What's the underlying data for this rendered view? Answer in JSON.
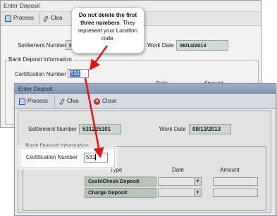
{
  "back_window": {
    "title": "Enter Deposit",
    "toolbar": {
      "process_label": "Process",
      "clear_label": "Clea"
    },
    "settlement_label": "Settlement Number",
    "settlement_value": "5",
    "workdate_label": "Work Date",
    "workdate_value": "08/13/2013",
    "group_title": "Bank Deposit Information",
    "cert_label": "Certification Number",
    "cert_value": "531",
    "col_date": "Date",
    "col_amount": "Amount"
  },
  "callout": {
    "bold_text": "Do not delete the first three numbers",
    "rest_text": ". They represent your Location code."
  },
  "front_window": {
    "title": "Enter Deposit",
    "toolbar": {
      "process_label": "Process",
      "clear_label": "Clea",
      "close_label": "Close"
    },
    "settlement_label": "Settlement Number",
    "settlement_value": "531225101",
    "workdate_label": "Work Date",
    "workdate_value": "08/13/2013",
    "group_title": "Bank Deposit Information",
    "cert_label": "Certification Number",
    "cert_value": "531",
    "col_type": "Type",
    "col_date": "Date",
    "col_amount": "Amount",
    "rows": [
      {
        "type": "Cash/Check Deposit"
      },
      {
        "type": "Charge Deposit"
      }
    ]
  },
  "colors": {
    "arrow": "#e01414",
    "selection": "#3a6fd0"
  }
}
